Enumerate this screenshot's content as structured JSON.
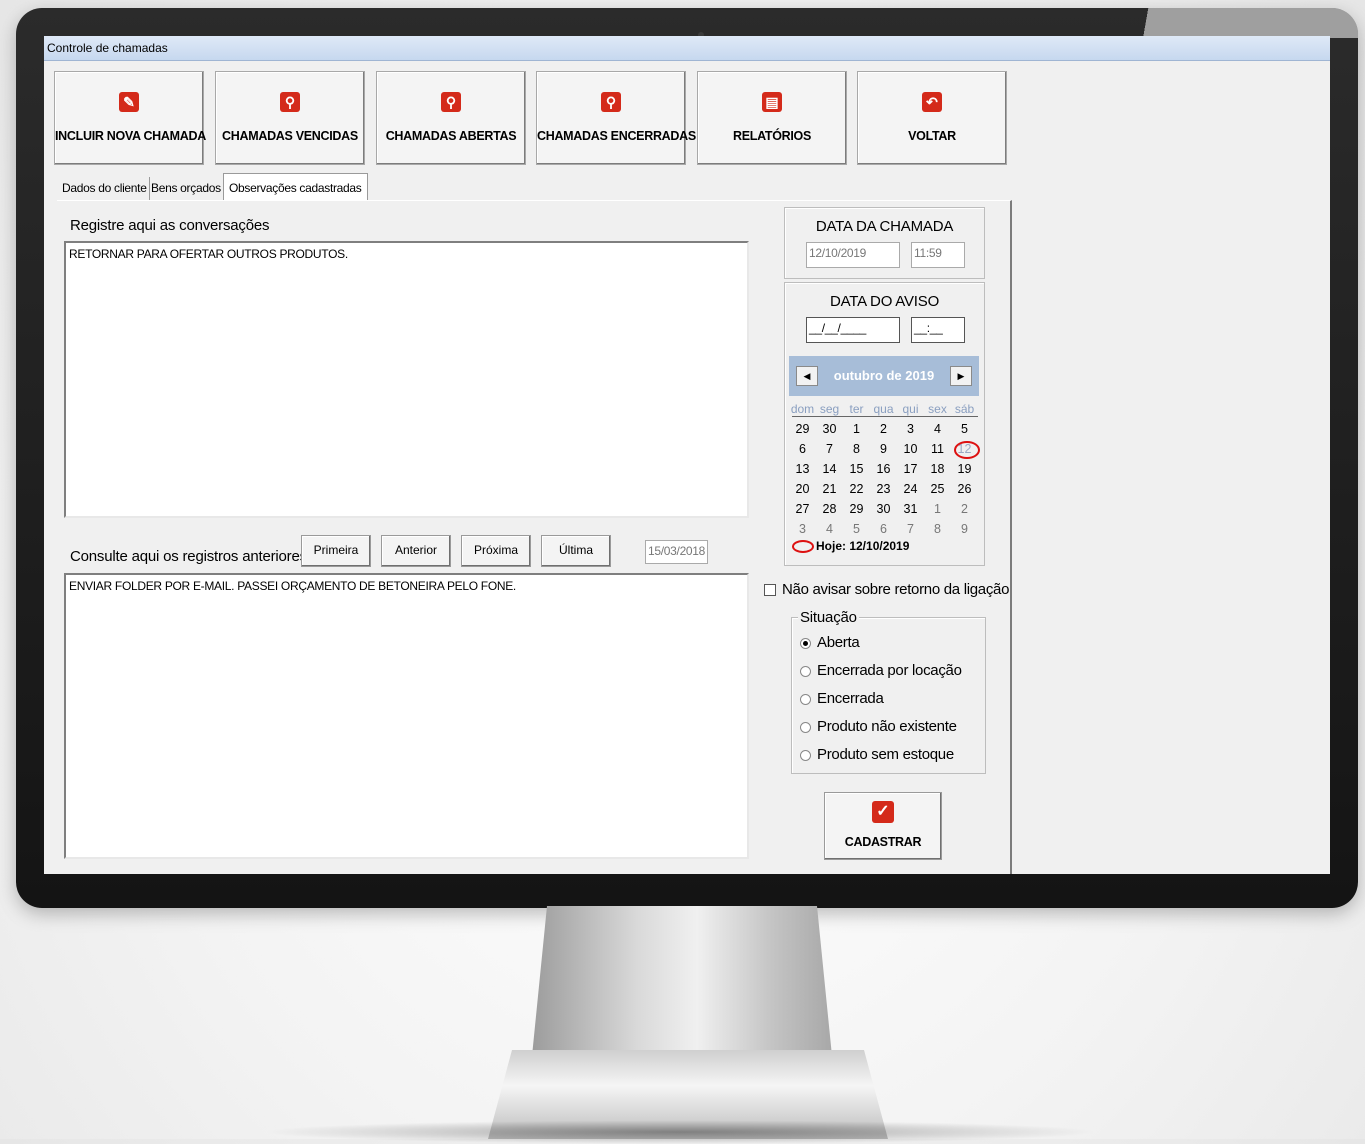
{
  "window": {
    "title": "Controle de chamadas"
  },
  "toolbar": [
    {
      "label": "INCLUIR NOVA CHAMADA",
      "icon": "edit-icon"
    },
    {
      "label": "CHAMADAS VENCIDAS",
      "icon": "search-icon"
    },
    {
      "label": "CHAMADAS ABERTAS",
      "icon": "search-icon"
    },
    {
      "label": "CHAMADAS ENCERRADAS",
      "icon": "search-icon"
    },
    {
      "label": "RELATÓRIOS",
      "icon": "document-icon"
    },
    {
      "label": "VOLTAR",
      "icon": "undo-icon"
    }
  ],
  "tabs": [
    {
      "label": "Dados do cliente"
    },
    {
      "label": "Bens orçados"
    },
    {
      "label": "Observações cadastradas"
    }
  ],
  "conversations": {
    "label": "Registre aqui as conversações",
    "value": "RETORNAR PARA OFERTAR OUTROS PRODUTOS."
  },
  "previous": {
    "label": "Consulte aqui os registros anteriores",
    "buttons": {
      "first": "Primeira",
      "prev": "Anterior",
      "next": "Próxima",
      "last": "Última"
    },
    "date": "15/03/2018",
    "value": "ENVIAR FOLDER POR E-MAIL. PASSEI ORÇAMENTO DE BETONEIRA PELO FONE."
  },
  "call_date": {
    "title": "DATA DA CHAMADA",
    "date": "12/10/2019",
    "time": "11:59"
  },
  "alert_date": {
    "title": "DATA DO AVISO",
    "date": "__/__/____",
    "time": "__:__"
  },
  "calendar": {
    "month": "outubro de 2019",
    "weekdays": [
      "dom",
      "seg",
      "ter",
      "qua",
      "qui",
      "sex",
      "sáb"
    ],
    "weeks": [
      [
        "29",
        "30",
        "1",
        "2",
        "3",
        "4",
        "5"
      ],
      [
        "6",
        "7",
        "8",
        "9",
        "10",
        "11",
        "12"
      ],
      [
        "13",
        "14",
        "15",
        "16",
        "17",
        "18",
        "19"
      ],
      [
        "20",
        "21",
        "22",
        "23",
        "24",
        "25",
        "26"
      ],
      [
        "27",
        "28",
        "29",
        "30",
        "31",
        "1",
        "2"
      ],
      [
        "3",
        "4",
        "5",
        "6",
        "7",
        "8",
        "9"
      ]
    ],
    "today_label": "Hoje: 12/10/2019"
  },
  "no_alert": {
    "label": "Não avisar sobre retorno da ligação",
    "checked": false
  },
  "status": {
    "title": "Situação",
    "options": [
      "Aberta",
      "Encerrada por locação",
      "Encerrada",
      "Produto não existente",
      "Produto sem estoque"
    ],
    "selected": "Aberta"
  },
  "save": {
    "label": "CADASTRAR"
  },
  "colors": {
    "accent": "#d42a1a",
    "calendar_header": "#a7bdd8"
  }
}
